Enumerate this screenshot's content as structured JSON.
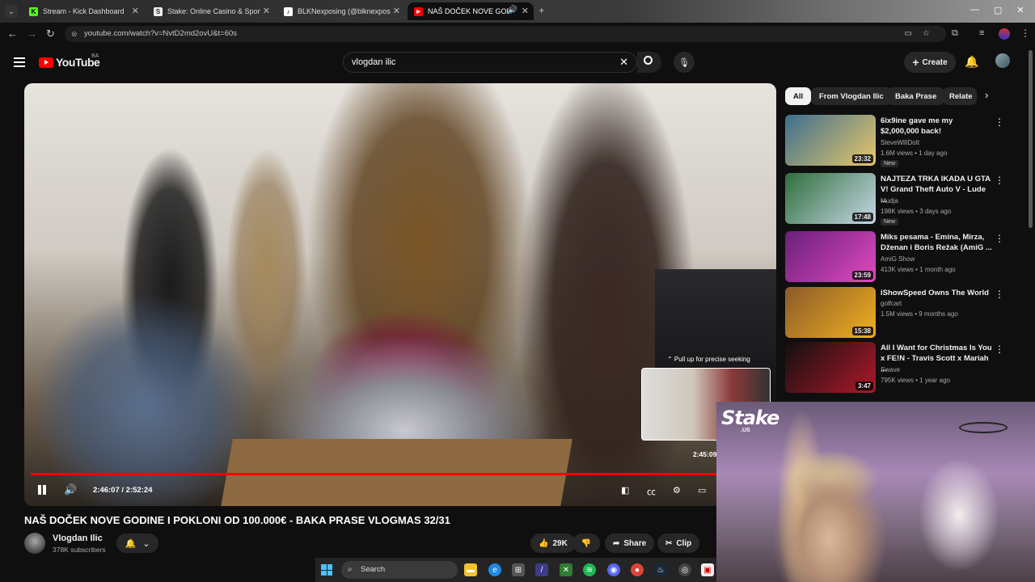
{
  "browser": {
    "tabs": [
      {
        "label": "Stream - Kick Dashboard",
        "icon": "kick-icon",
        "color": "#53fc18",
        "letter": "K"
      },
      {
        "label": "Stake: Online Casino & Sports",
        "icon": "stake-icon",
        "color": "#1a2c38",
        "letter": "S"
      },
      {
        "label": "BLKNexposing (@blknexposing)",
        "icon": "tiktok-icon",
        "color": "#000000",
        "letter": "♪"
      },
      {
        "label": "NAŠ DOČEK NOVE GODINE",
        "icon": "youtube-icon",
        "color": "#ff0000",
        "letter": "▶"
      }
    ],
    "url": "youtube.com/watch?v=NvtD2md2ovU&t=60s"
  },
  "header": {
    "logo": "YouTube",
    "country": "BA",
    "search_value": "vlogdan ilic",
    "create_label": "Create"
  },
  "player": {
    "seek_hint": "⌃ Pull up for precise seeking",
    "preview_time": "2:45:09",
    "time_display": "2:46:07 / 2:52:24",
    "progress": 0.965
  },
  "video": {
    "title": "NAŠ DOČEK NOVE GODINE I POKLONI OD 100.000€ - BAKA PRASE VLOGMAS 32/31",
    "channel": "Vlogdan Ilic",
    "subscribers": "378K subscribers",
    "likes": "29K",
    "share_label": "Share",
    "clip_label": "Clip"
  },
  "sidebar": {
    "chips": [
      "All",
      "From Vlogdan Ilic",
      "Baka Prase",
      "Relate"
    ],
    "recs": [
      {
        "title": "6ix9ine gave me my $2,000,000 back!",
        "channel": "SteveWillDoIt",
        "views": "1.6M views • 1 day ago",
        "duration": "23:32",
        "new": "New",
        "c1": "#3b6e8f",
        "c2": "#e8c86a"
      },
      {
        "title": "NAJTEZA TRKA IKADA U GTA V! Grand Theft Auto V - Lude ...",
        "channel": "Mudja",
        "views": "198K views • 3 days ago",
        "duration": "17:48",
        "new": "New",
        "c1": "#2e6e3a",
        "c2": "#c8d8e8"
      },
      {
        "title": "Miks pesama - Emina, Mirza, Dženan i Boris Režak (AmiG ...",
        "channel": "AmiG Show",
        "views": "413K views • 1 month ago",
        "duration": "23:59",
        "new": "",
        "c1": "#6a1f7a",
        "c2": "#e04ac0"
      },
      {
        "title": "iShowSpeed Owns The World",
        "channel": "golfcart",
        "views": "1.5M views • 9 months ago",
        "duration": "15:38",
        "new": "",
        "c1": "#8a5a2a",
        "c2": "#f0b020"
      },
      {
        "title": "All I Want for Christmas Is You x FE!N - Travis Scott x Mariah ...",
        "channel": "Swave",
        "views": "795K views • 1 year ago",
        "duration": "3:47",
        "new": "",
        "c1": "#101010",
        "c2": "#b0182a"
      }
    ]
  },
  "overlay": {
    "brand": "Stake",
    "brand_sub": ".US"
  },
  "taskbar": {
    "search_placeholder": "Search"
  }
}
